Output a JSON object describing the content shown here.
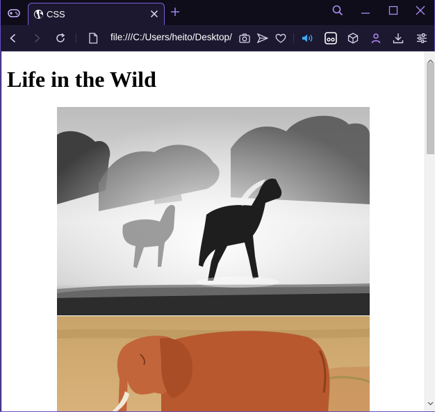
{
  "tabbar": {
    "tab_title": "CSS"
  },
  "toolbar": {
    "url": "file:///C:/Users/heito/Desktop/"
  },
  "page": {
    "heading": "Life in the Wild",
    "images": [
      {
        "name": "horses-photo",
        "description": "two horses running in dust"
      },
      {
        "name": "elephant-photo",
        "description": "elephant in savanna"
      }
    ]
  },
  "colors": {
    "accent": "#7e5fd8",
    "chrome_bg": "#0f0d1a",
    "toolbar_bg": "#1c1830",
    "icon": "#d9d4ec",
    "speaker": "#3fa9f5"
  },
  "icons": [
    "gamepad-icon",
    "globe-icon",
    "close-icon",
    "plus-icon",
    "search-icon",
    "minimize-icon",
    "maximize-icon",
    "window-close-icon",
    "back-icon",
    "forward-icon",
    "reload-icon",
    "page-icon",
    "camera-icon",
    "send-icon",
    "heart-icon",
    "speaker-icon",
    "reader-icon",
    "cube-icon",
    "profile-icon",
    "download-icon",
    "settings-sliders-icon"
  ]
}
